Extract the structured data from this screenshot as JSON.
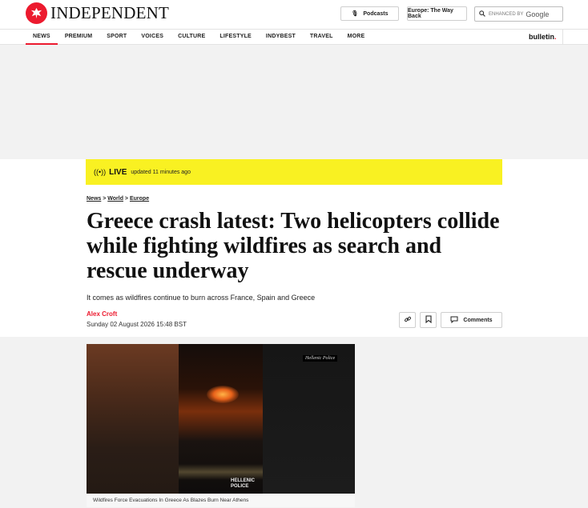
{
  "header": {
    "logo_text": "INDEPENDENT",
    "podcasts_label": "Podcasts",
    "wayback_label": "Europe: The Way Back",
    "search_prefix": "ENHANCED BY",
    "search_brand": "Google"
  },
  "nav": {
    "items": [
      "NEWS",
      "PREMIUM",
      "SPORT",
      "VOICES",
      "CULTURE",
      "LIFESTYLE",
      "INDYBEST",
      "TRAVEL",
      "MORE"
    ],
    "bulletin": "bulletin",
    "bulletin_dot": "."
  },
  "live": {
    "label": "LIVE",
    "updated": "updated  11 minutes ago"
  },
  "breadcrumb": {
    "items": [
      "News",
      "World",
      "Europe"
    ],
    "separator": " > "
  },
  "article": {
    "headline": "Greece crash latest: Two helicopters collide while fighting wildfires as search and rescue underway",
    "standfirst": "It comes as wildfires continue to burn across France, Spain and Greece",
    "author": "Alex Croft",
    "date": "Sunday 02 August 2026 15:48 BST",
    "comments_label": "Comments"
  },
  "video": {
    "watermark_top": "Hellenic Police",
    "watermark_bottom_1": "HELLENIC",
    "watermark_bottom_2": "POLICE",
    "caption": "Wildfires Force Evacuations In Greece As Blazes Burn Near Athens"
  },
  "colors": {
    "brand_red": "#ec1a2e",
    "live_yellow": "#f9f122"
  }
}
